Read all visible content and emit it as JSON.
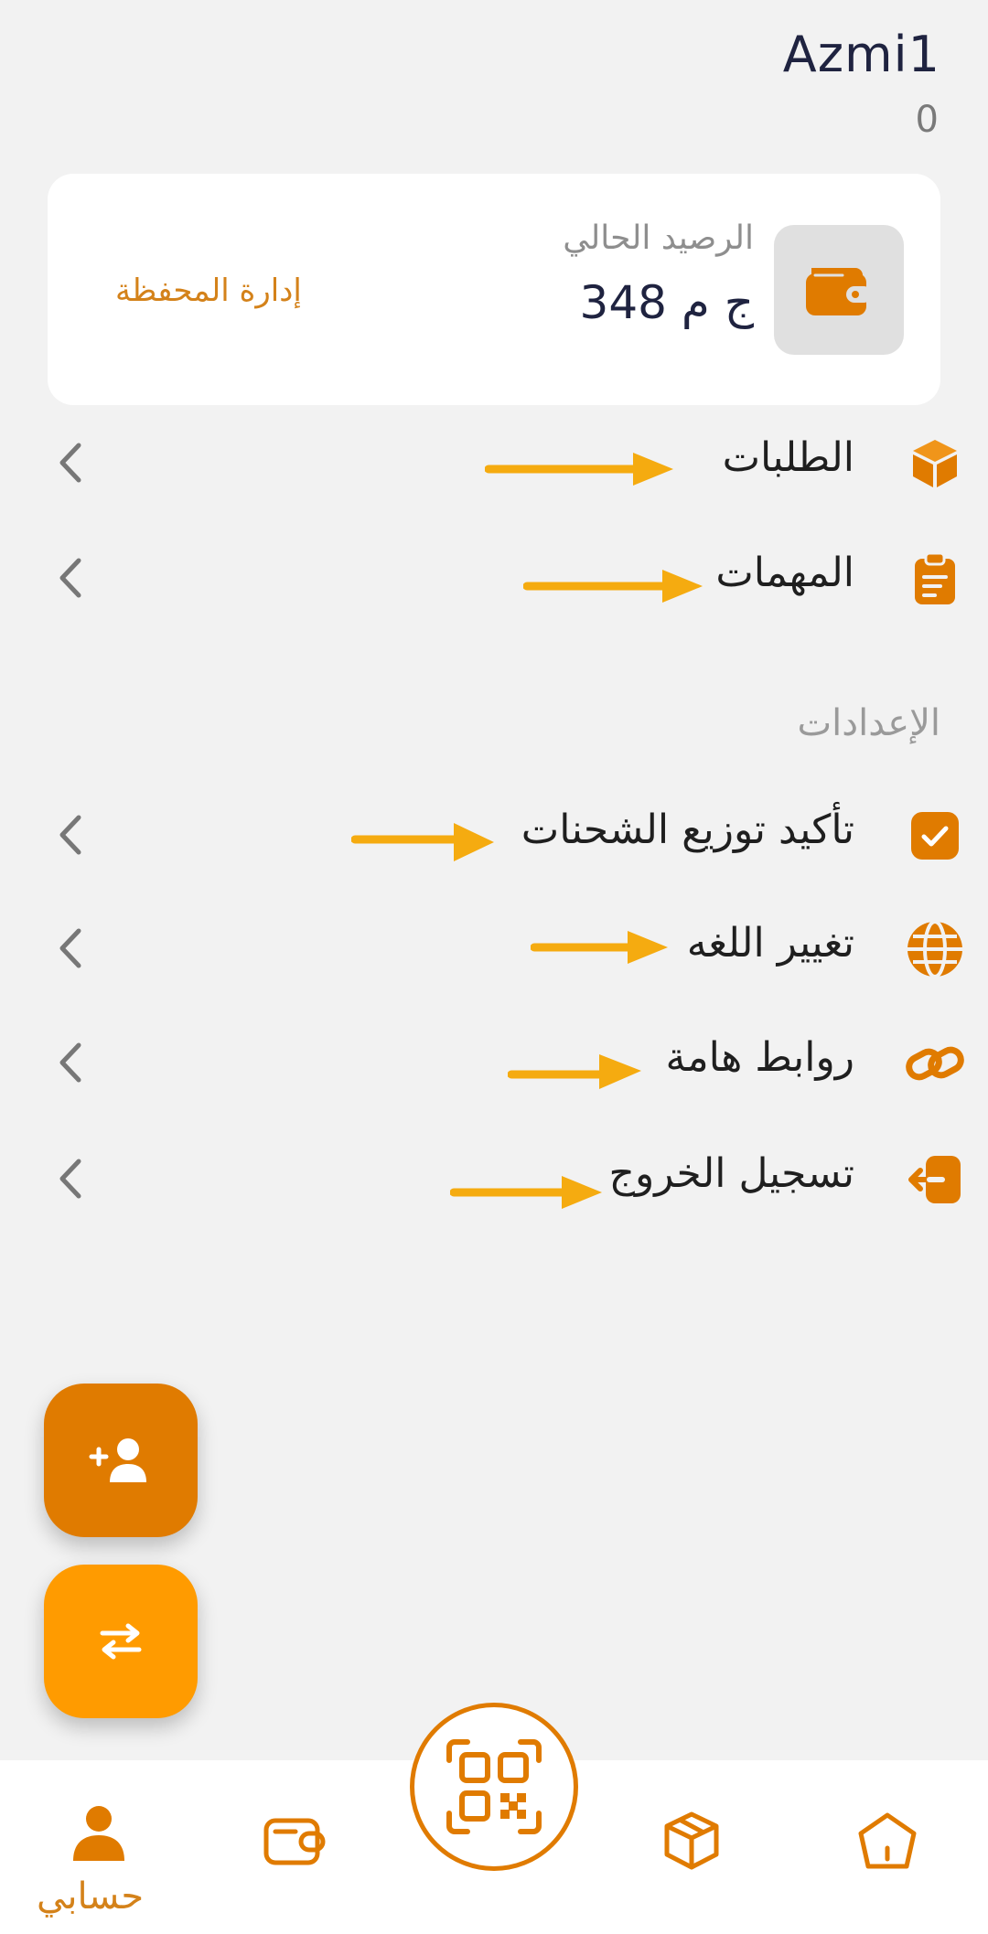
{
  "profile": {
    "username": "Azmi1",
    "count": "0"
  },
  "balance": {
    "label": "الرصيد الحالي",
    "value": "348 ج م",
    "manage_label": "إدارة المحفظة"
  },
  "menu": {
    "orders": "الطلبات",
    "tasks": "المهمات",
    "settings_title": "الإعدادات",
    "confirm_shipments": "تأكيد توزيع الشحنات",
    "change_language": "تغيير اللغه",
    "important_links": "روابط هامة",
    "logout": "تسجيل الخروج"
  },
  "bottom_nav": {
    "account_label": "حسابي"
  },
  "colors": {
    "accent": "#e07b00",
    "accent_light": "#ff9b00",
    "arrow": "#f5ab10",
    "background": "#f2f2f2"
  },
  "icons": {
    "wallet": "wallet-icon",
    "orders": "box-icon",
    "tasks": "clipboard-icon",
    "confirm": "checkbox-icon",
    "language": "globe-icon",
    "links": "link-icon",
    "logout": "logout-icon",
    "chevron": "chevron-left-icon",
    "add_user": "add-user-icon",
    "transfer": "swap-icon",
    "qr": "qr-code-icon",
    "home": "home-icon",
    "account": "person-icon"
  }
}
